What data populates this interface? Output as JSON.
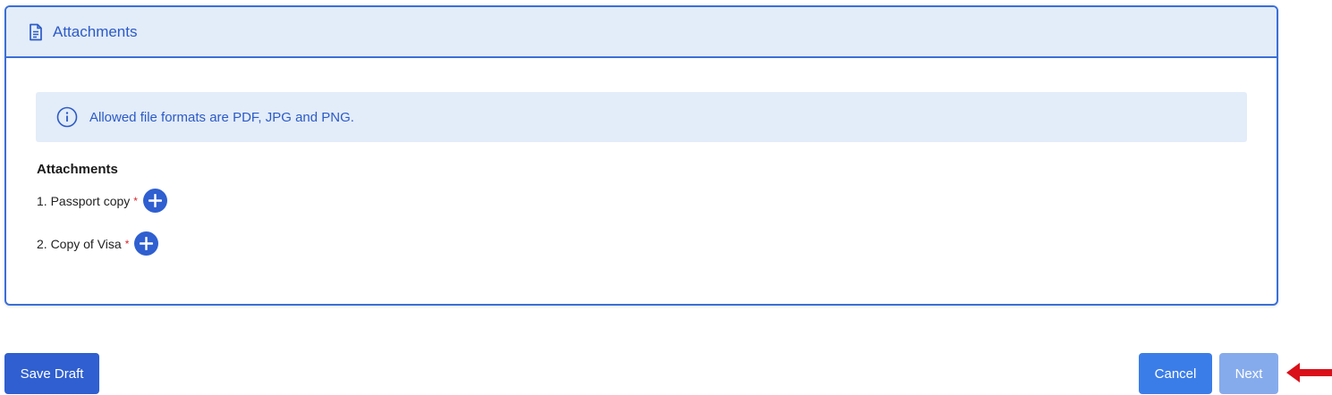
{
  "panel": {
    "title": "Attachments",
    "title_icon": "document-icon"
  },
  "info_banner": {
    "icon": "info-icon",
    "text": "Allowed file formats are PDF, JPG and PNG."
  },
  "attachments": {
    "heading": "Attachments",
    "items": [
      {
        "label": "1. Passport copy",
        "required_mark": "*"
      },
      {
        "label": "2. Copy of Visa",
        "required_mark": "*"
      }
    ]
  },
  "footer": {
    "save_draft_label": "Save Draft",
    "cancel_label": "Cancel",
    "next_label": "Next"
  },
  "colors": {
    "primary": "#2f5fd0",
    "accent_blue": "#3b7de8",
    "disabled_blue": "#86abec",
    "header_bg": "#e3ecf9",
    "required_red": "#d9262a",
    "annotation_arrow": "#d9101a"
  }
}
